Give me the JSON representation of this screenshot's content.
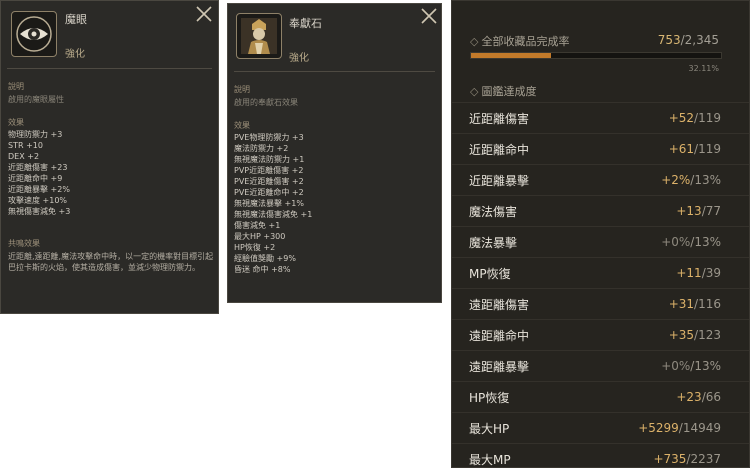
{
  "eye_panel": {
    "title": "魔眼",
    "subtitle": "強化",
    "icon": "eye-emblem-icon",
    "desc_heading": "說明",
    "desc_text": "啟用的魔眼屬性",
    "effect_heading": "效果",
    "effects": [
      "物理防禦力 +3",
      "STR +10",
      "DEX +2",
      "近距離傷害 +23",
      "近距離命中 +9",
      "近距離暴擊 +2%",
      "攻擊速度 +10%",
      "無視傷害減免 +3"
    ],
    "resonance_heading": "共鳴效果",
    "resonance_text": "近距離,遠距離,魔法攻擊命中時，以一定的機率對目標引起巴拉卡斯的火焰，使其造成傷害，並減少物理防禦力。"
  },
  "stone_panel": {
    "title": "奉獻石",
    "subtitle": "強化",
    "icon": "offering-stone-figure-icon",
    "desc_heading": "說明",
    "desc_text": "啟用的奉獻石效果",
    "effect_heading": "效果",
    "effects": [
      "PVE物理防禦力 +3",
      "魔法防禦力 +2",
      "無視魔法防禦力 +1",
      "PVP近距離傷害 +2",
      "PVE近距離傷害 +2",
      "PVE近距離命中 +2",
      "無視魔法暴擊 +1%",
      "無視魔法傷害減免 +1",
      "傷害減免 +1",
      "最大HP +300",
      "HP恢復 +2",
      "經驗值獎勵 +9%",
      "昏迷 命中 +8%"
    ]
  },
  "collection": {
    "header": "全部收藏品完成率",
    "current": "753",
    "total": "/2,345",
    "progress_fraction": 0.3211,
    "percent_text": "32.11%",
    "achievement_header": "圖鑑達成度",
    "rows": [
      {
        "label": "近距離傷害",
        "bonus": "+52",
        "max": "/119",
        "tone": "gold"
      },
      {
        "label": "近距離命中",
        "bonus": "+61",
        "max": "/119",
        "tone": "gold"
      },
      {
        "label": "近距離暴擊",
        "bonus": "+2%",
        "max": "/13%",
        "tone": "gold"
      },
      {
        "label": "魔法傷害",
        "bonus": "+13",
        "max": "/77",
        "tone": "gold"
      },
      {
        "label": "魔法暴擊",
        "bonus": "+0%",
        "max": "/13%",
        "tone": "grey"
      },
      {
        "label": "MP恢復",
        "bonus": "+11",
        "max": "/39",
        "tone": "gold"
      },
      {
        "label": "遠距離傷害",
        "bonus": "+31",
        "max": "/116",
        "tone": "gold"
      },
      {
        "label": "遠距離命中",
        "bonus": "+35",
        "max": "/123",
        "tone": "gold"
      },
      {
        "label": "遠距離暴擊",
        "bonus": "+0%",
        "max": "/13%",
        "tone": "grey"
      },
      {
        "label": "HP恢復",
        "bonus": "+23",
        "max": "/66",
        "tone": "gold"
      },
      {
        "label": "最大HP",
        "bonus": "+5299",
        "max": "/14949",
        "tone": "gold"
      },
      {
        "label": "最大MP",
        "bonus": "+735",
        "max": "/2237",
        "tone": "gold"
      }
    ]
  },
  "colors": {
    "panel_bg": "#2b2a27",
    "gold_value": "#dcb26a",
    "progress_fill": "#c27a2a"
  }
}
